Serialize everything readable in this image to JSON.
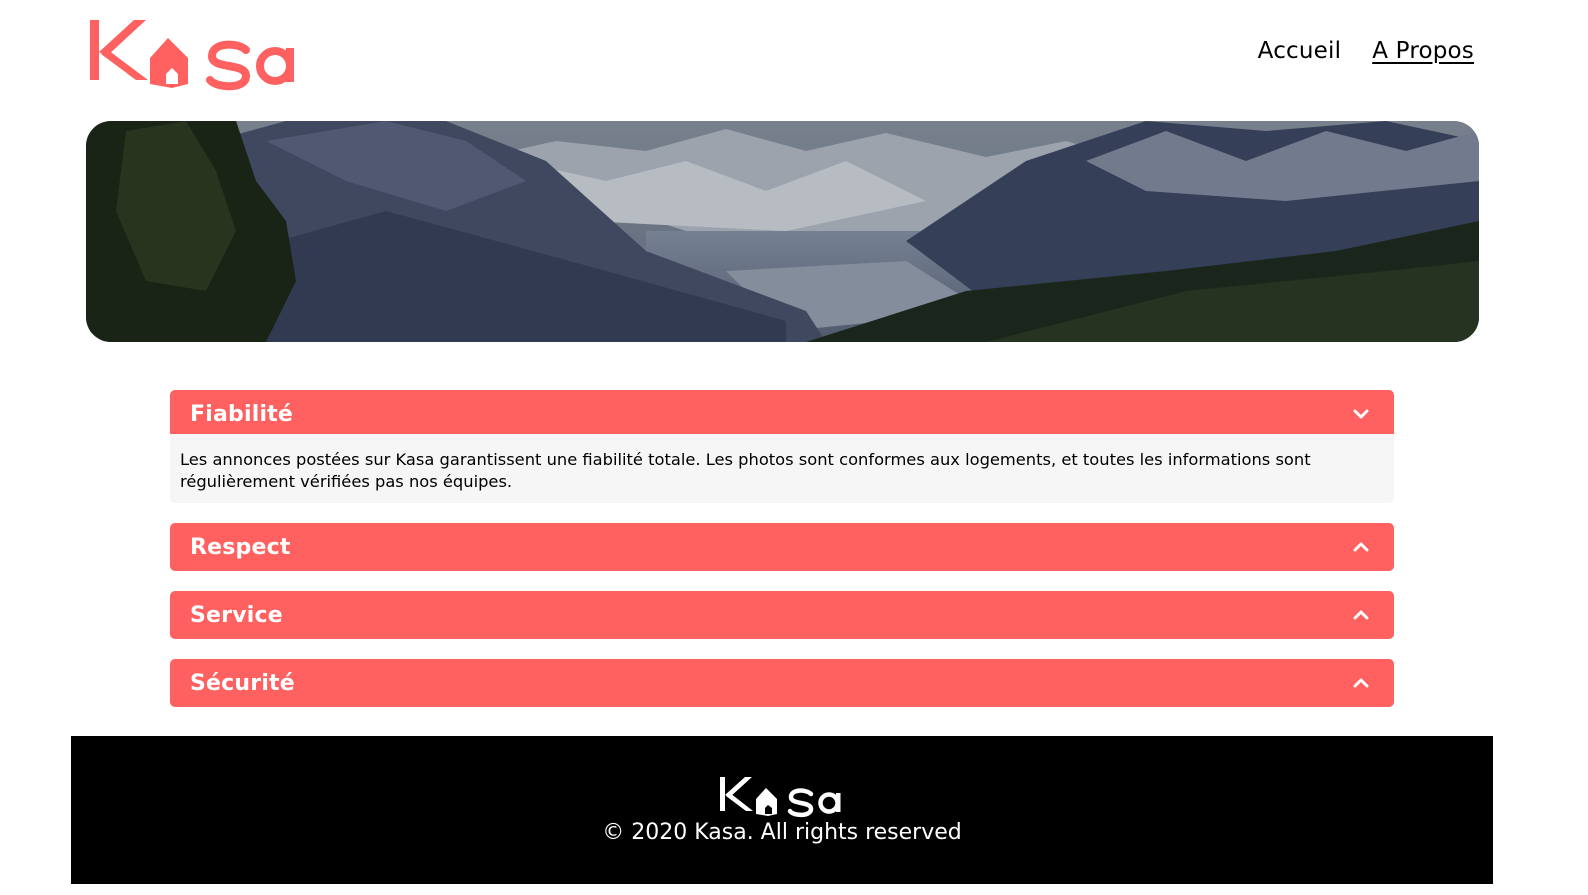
{
  "brand": {
    "name": "Kasa",
    "color": "#ff6060"
  },
  "nav": {
    "items": [
      {
        "label": "Accueil"
      },
      {
        "label": "A Propos"
      }
    ]
  },
  "collapses": [
    {
      "title": "Fiabilité",
      "expanded": true,
      "icon": "chevron-down-icon",
      "content": "Les annonces postées sur Kasa garantissent une fiabilité totale. Les photos sont conformes aux logements, et toutes les informations sont régulièrement vérifiées pas nos équipes."
    },
    {
      "title": "Respect",
      "expanded": false,
      "icon": "chevron-up-icon"
    },
    {
      "title": "Service",
      "expanded": false,
      "icon": "chevron-up-icon"
    },
    {
      "title": "Sécurité",
      "expanded": false,
      "icon": "chevron-up-icon"
    }
  ],
  "footer": {
    "copyright": "© 2020 Kasa. All rights reserved"
  }
}
